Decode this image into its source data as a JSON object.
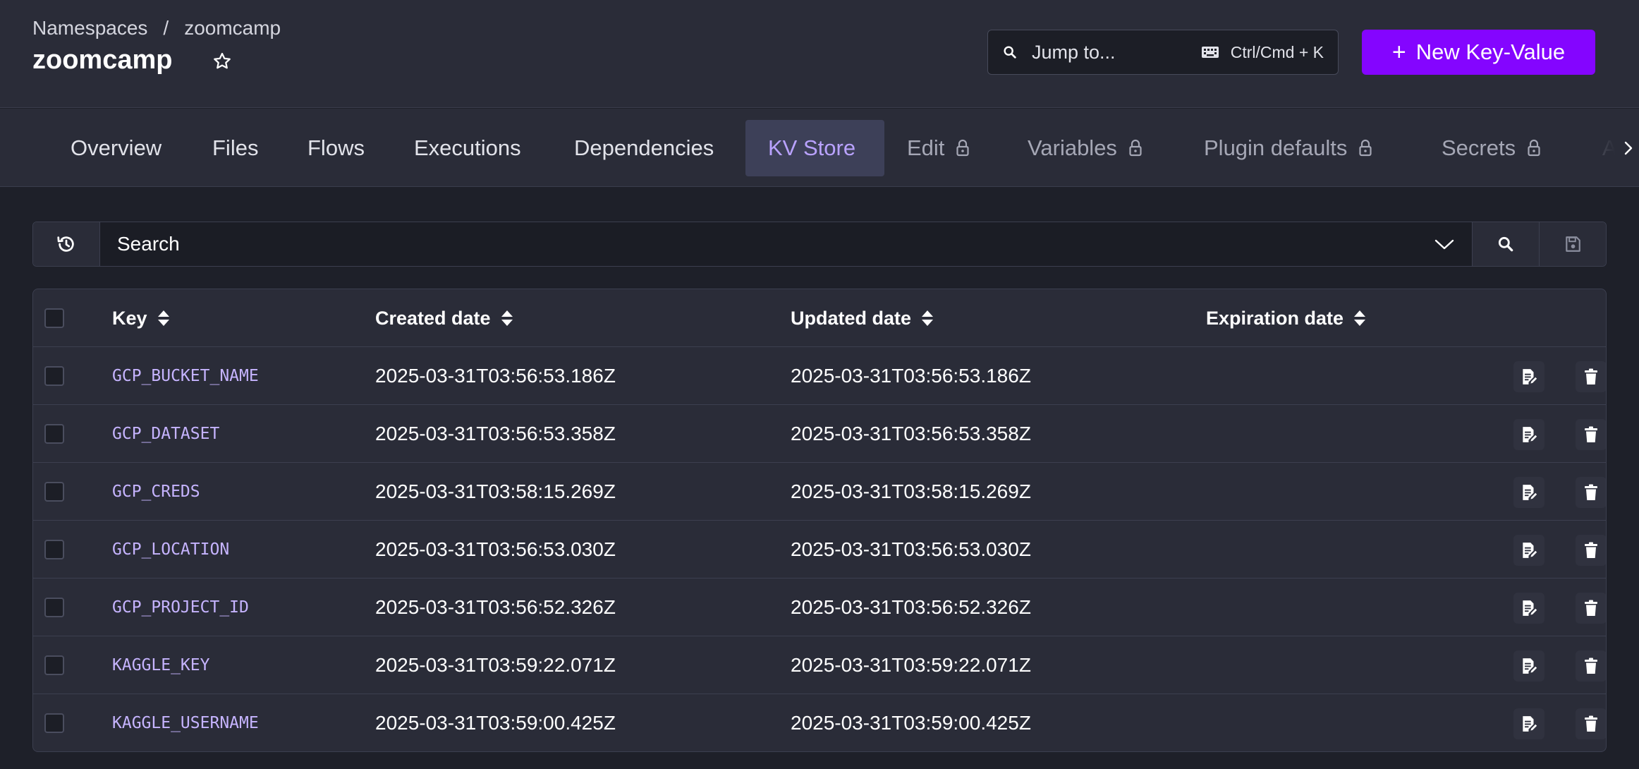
{
  "header": {
    "breadcrumb": [
      "Namespaces",
      "zoomcamp"
    ],
    "breadcrumb_sep": "/",
    "title": "zoomcamp",
    "jump": {
      "placeholder": "Jump to...",
      "shortcut": "Ctrl/Cmd + K"
    },
    "new_button": {
      "plus": "+",
      "label": "New Key-Value"
    }
  },
  "tabs": [
    {
      "label": "Overview",
      "active": false,
      "locked": false
    },
    {
      "label": "Files",
      "active": false,
      "locked": false
    },
    {
      "label": "Flows",
      "active": false,
      "locked": false
    },
    {
      "label": "Executions",
      "active": false,
      "locked": false
    },
    {
      "label": "Dependencies",
      "active": false,
      "locked": false
    },
    {
      "label": "KV Store",
      "active": true,
      "locked": false
    },
    {
      "label": "Edit",
      "active": false,
      "locked": true
    },
    {
      "label": "Variables",
      "active": false,
      "locked": true
    },
    {
      "label": "Plugin defaults",
      "active": false,
      "locked": true
    },
    {
      "label": "Secrets",
      "active": false,
      "locked": true
    },
    {
      "label": "A",
      "active": false,
      "locked": false
    }
  ],
  "search": {
    "placeholder": "Search"
  },
  "table": {
    "columns": {
      "key": "Key",
      "created": "Created date",
      "updated": "Updated date",
      "expiration": "Expiration date"
    },
    "rows": [
      {
        "key": "GCP_BUCKET_NAME",
        "created": "2025-03-31T03:56:53.186Z",
        "updated": "2025-03-31T03:56:53.186Z",
        "expiration": ""
      },
      {
        "key": "GCP_DATASET",
        "created": "2025-03-31T03:56:53.358Z",
        "updated": "2025-03-31T03:56:53.358Z",
        "expiration": ""
      },
      {
        "key": "GCP_CREDS",
        "created": "2025-03-31T03:58:15.269Z",
        "updated": "2025-03-31T03:58:15.269Z",
        "expiration": ""
      },
      {
        "key": "GCP_LOCATION",
        "created": "2025-03-31T03:56:53.030Z",
        "updated": "2025-03-31T03:56:53.030Z",
        "expiration": ""
      },
      {
        "key": "GCP_PROJECT_ID",
        "created": "2025-03-31T03:56:52.326Z",
        "updated": "2025-03-31T03:56:52.326Z",
        "expiration": ""
      },
      {
        "key": "KAGGLE_KEY",
        "created": "2025-03-31T03:59:22.071Z",
        "updated": "2025-03-31T03:59:22.071Z",
        "expiration": ""
      },
      {
        "key": "KAGGLE_USERNAME",
        "created": "2025-03-31T03:59:00.425Z",
        "updated": "2025-03-31T03:59:00.425Z",
        "expiration": ""
      }
    ]
  },
  "icons": {
    "star": "star-outline-icon",
    "search": "search-icon",
    "keyboard": "keyboard-icon",
    "lock": "lock-icon",
    "chevron": "chevron-right-icon",
    "history": "history-icon",
    "dropdown": "chevron-down-icon",
    "save": "save-icon",
    "sort": "sort-icon",
    "edit": "edit-icon",
    "delete": "trash-icon"
  },
  "colors": {
    "accent": "#8405ff",
    "active_tab_text": "#b9a2ff",
    "key_text": "#c6b4ff",
    "background": "#1e2029",
    "panel": "#2a2c38"
  }
}
